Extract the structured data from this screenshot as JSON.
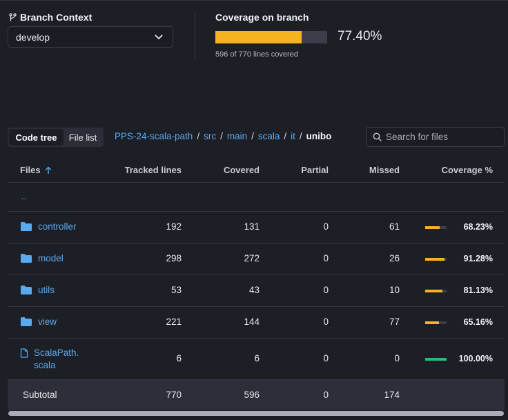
{
  "branch": {
    "title": "Branch Context",
    "icon": "git-branch-icon",
    "selected": "develop"
  },
  "coverage": {
    "title": "Coverage on branch",
    "percent": 77.4,
    "percent_label": "77.40%",
    "summary": "596 of 770 lines covered"
  },
  "toolbar": {
    "tabs": [
      "Code tree",
      "File list"
    ],
    "active_tab": "Code tree",
    "breadcrumb": [
      "PPS-24-scala-path",
      "src",
      "main",
      "scala",
      "it"
    ],
    "breadcrumb_separator": "/",
    "breadcrumb_current": "unibo",
    "search_placeholder": "Search for files"
  },
  "table": {
    "headers": {
      "files": "Files",
      "tracked": "Tracked lines",
      "covered": "Covered",
      "partial": "Partial",
      "missed": "Missed",
      "coverage": "Coverage %"
    },
    "parent_link": "..",
    "rows": [
      {
        "name": "controller",
        "type": "folder",
        "tracked": "192",
        "covered": "131",
        "partial": "0",
        "missed": "61",
        "coverage": 68.23,
        "coverage_label": "68.23%"
      },
      {
        "name": "model",
        "type": "folder",
        "tracked": "298",
        "covered": "272",
        "partial": "0",
        "missed": "26",
        "coverage": 91.28,
        "coverage_label": "91.28%"
      },
      {
        "name": "utils",
        "type": "folder",
        "tracked": "53",
        "covered": "43",
        "partial": "0",
        "missed": "10",
        "coverage": 81.13,
        "coverage_label": "81.13%"
      },
      {
        "name": "view",
        "type": "folder",
        "tracked": "221",
        "covered": "144",
        "partial": "0",
        "missed": "77",
        "coverage": 65.16,
        "coverage_label": "65.16%"
      },
      {
        "name": "ScalaPath.\nscala",
        "name_line1": "ScalaPath.",
        "name_line2": "scala",
        "type": "file",
        "tracked": "6",
        "covered": "6",
        "partial": "0",
        "missed": "0",
        "coverage": 100.0,
        "coverage_label": "100.00%"
      }
    ],
    "subtotal": {
      "label": "Subtotal",
      "tracked": "770",
      "covered": "596",
      "partial": "0",
      "missed": "174"
    }
  },
  "colors": {
    "accent_yellow": "#f5b41f",
    "accent_green": "#2fb67a",
    "link_blue": "#5aaaf0",
    "background": "#1d1f27"
  }
}
